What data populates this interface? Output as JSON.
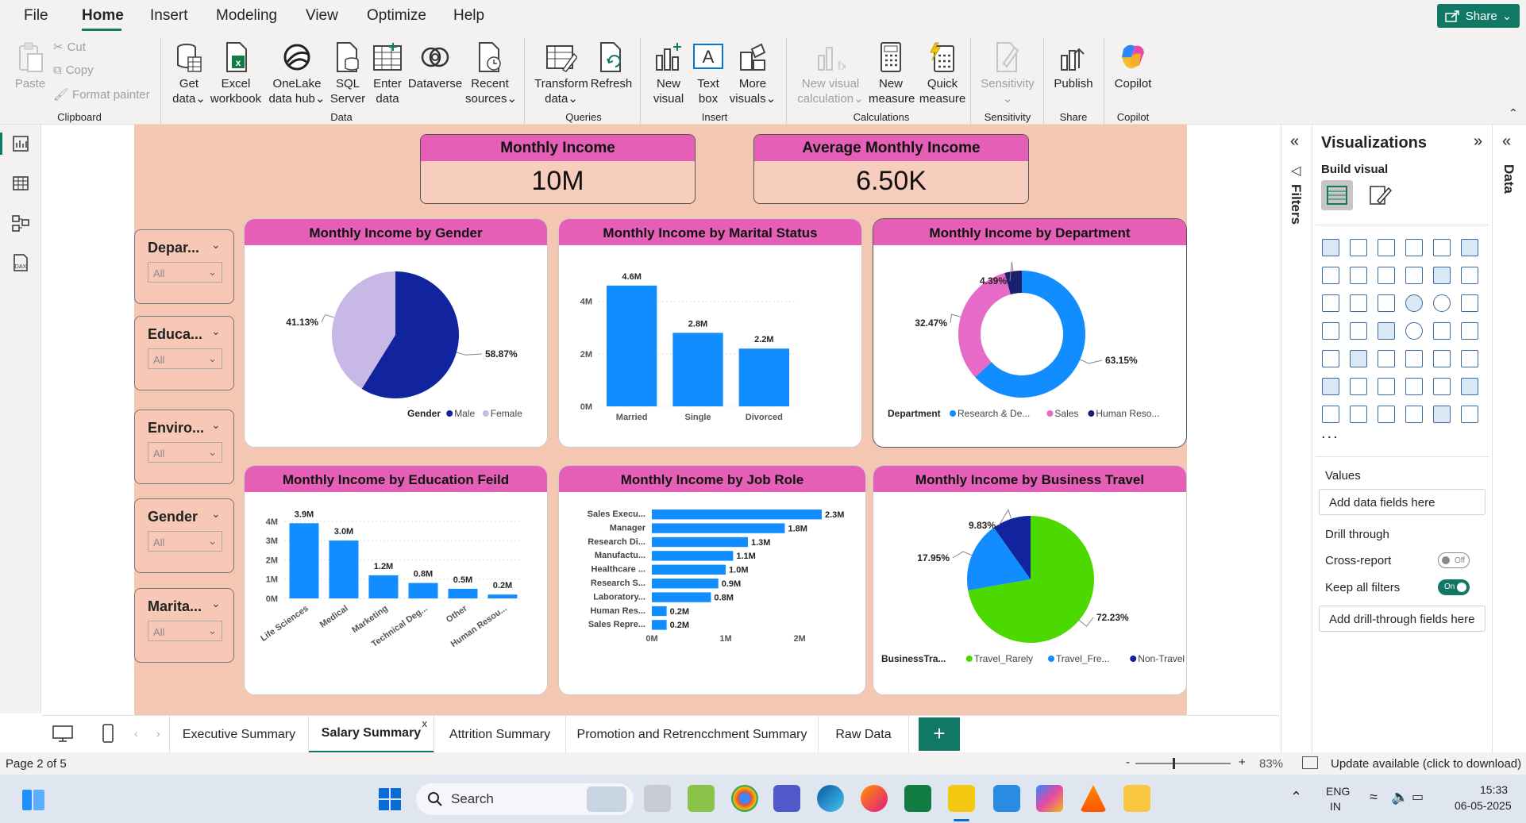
{
  "menu": {
    "file": "File",
    "home": "Home",
    "insert": "Insert",
    "modeling": "Modeling",
    "view": "View",
    "optimize": "Optimize",
    "help": "Help",
    "share": "Share"
  },
  "ribbon": {
    "clipboard": {
      "paste": "Paste",
      "cut": "Cut",
      "copy": "Copy",
      "format_painter": "Format painter",
      "label": "Clipboard"
    },
    "data": {
      "get_data": [
        "Get",
        "data"
      ],
      "excel": [
        "Excel",
        "workbook"
      ],
      "onelake": [
        "OneLake",
        "data hub"
      ],
      "sql": [
        "SQL",
        "Server"
      ],
      "enter": [
        "Enter",
        "data"
      ],
      "dataverse": "Dataverse",
      "recent": [
        "Recent",
        "sources"
      ],
      "label": "Data"
    },
    "queries": {
      "transform": [
        "Transform",
        "data"
      ],
      "refresh": "Refresh",
      "label": "Queries"
    },
    "insert": {
      "new_visual": [
        "New",
        "visual"
      ],
      "text_box": [
        "Text",
        "box"
      ],
      "more": [
        "More",
        "visuals"
      ],
      "label": "Insert"
    },
    "calculations": {
      "new_visual_calc": [
        "New visual",
        "calculation"
      ],
      "new_measure": [
        "New",
        "measure"
      ],
      "quick_measure": [
        "Quick",
        "measure"
      ],
      "label": "Calculations"
    },
    "sensitivity": {
      "btn": "Sensitivity",
      "label": "Sensitivity"
    },
    "share": {
      "publish": "Publish",
      "label": "Share"
    },
    "copilot": {
      "btn": "Copilot",
      "label": "Copilot"
    }
  },
  "kpis": [
    {
      "title": "Monthly Income",
      "value": "10M"
    },
    {
      "title": "Average Monthly Income",
      "value": "6.50K"
    }
  ],
  "slicers": [
    {
      "title": "Depar...",
      "value": "All"
    },
    {
      "title": "Educa...",
      "value": "All"
    },
    {
      "title": "Enviro...",
      "value": "All"
    },
    {
      "title": "Gender",
      "value": "All"
    },
    {
      "title": "Marita...",
      "value": "All"
    }
  ],
  "chart_data": [
    {
      "type": "pie",
      "title": "Monthly Income by Gender",
      "legend_title": "Gender",
      "categories": [
        "Male",
        "Female"
      ],
      "values": [
        58.87,
        41.13
      ],
      "labels": [
        "58.87%",
        "41.13%"
      ],
      "colors": [
        "#12239e",
        "#c7b8e6"
      ],
      "legend": "bottom-right"
    },
    {
      "type": "bar",
      "title": "Monthly Income by Marital Status",
      "categories": [
        "Married",
        "Single",
        "Divorced"
      ],
      "values": [
        4.6,
        2.8,
        2.2
      ],
      "labels": [
        "4.6M",
        "2.8M",
        "2.2M"
      ],
      "ylim": [
        0,
        5.2
      ],
      "yticks": [
        "0M",
        "2M",
        "4M"
      ],
      "color": "#118dff"
    },
    {
      "type": "pie",
      "title": "Monthly Income by Department",
      "legend_title": "Department",
      "donut": true,
      "categories": [
        "Research & De...",
        "Sales",
        "Human Reso..."
      ],
      "values": [
        63.15,
        32.47,
        4.39
      ],
      "labels": [
        "63.15%",
        "32.47%",
        "4.39%"
      ],
      "colors": [
        "#118dff",
        "#e66ac8",
        "#1a1f6e"
      ],
      "legend": "bottom"
    },
    {
      "type": "bar",
      "title": "Monthly Income by Education Feild",
      "categories": [
        "Life Sciences",
        "Medical",
        "Marketing",
        "Technical Deg...",
        "Other",
        "Human Resou..."
      ],
      "values": [
        3.9,
        3.0,
        1.2,
        0.8,
        0.5,
        0.2
      ],
      "labels": [
        "3.9M",
        "3.0M",
        "1.2M",
        "0.8M",
        "0.5M",
        "0.2M"
      ],
      "ylim": [
        0,
        4.2
      ],
      "yticks": [
        "0M",
        "1M",
        "2M",
        "3M",
        "4M"
      ],
      "color": "#118dff"
    },
    {
      "type": "bar",
      "orientation": "horizontal",
      "title": "Monthly Income by Job Role",
      "categories": [
        "Sales Execu...",
        "Manager",
        "Research Di...",
        "Manufactu...",
        "Healthcare ...",
        "Research S...",
        "Laboratory...",
        "Human Res...",
        "Sales Repre..."
      ],
      "values": [
        2.3,
        1.8,
        1.3,
        1.1,
        1.0,
        0.9,
        0.8,
        0.2,
        0.2
      ],
      "labels": [
        "2.3M",
        "1.8M",
        "1.3M",
        "1.1M",
        "1.0M",
        "0.9M",
        "0.8M",
        "0.2M",
        "0.2M"
      ],
      "xlim": [
        0,
        2.3
      ],
      "xticks": [
        "0M",
        "1M",
        "2M"
      ],
      "color": "#118dff"
    },
    {
      "type": "pie",
      "title": "Monthly Income by Business Travel",
      "legend_title": "BusinessTra...",
      "categories": [
        "Travel_Rarely",
        "Travel_Fre...",
        "Non-Travel"
      ],
      "values": [
        72.23,
        17.95,
        9.83
      ],
      "labels": [
        "72.23%",
        "17.95%",
        "9.83%"
      ],
      "colors": [
        "#4cd900",
        "#118dff",
        "#12239e"
      ],
      "legend": "bottom"
    }
  ],
  "tabs": [
    "Executive Summary",
    "Salary Summary",
    "Attrition Summary",
    "Promotion and Retrencchment Summary",
    "Raw Data"
  ],
  "tab_close": "x",
  "status": {
    "page": "Page 2 of 5",
    "zoom": "83%",
    "update": "Update available (click to download)",
    "zoom_minus": "-",
    "zoom_plus": "+"
  },
  "filters_label": "Filters",
  "data_label": "Data",
  "viz": {
    "title": "Visualizations",
    "build": "Build visual",
    "values": "Values",
    "add_fields": "Add data fields here",
    "drill": "Drill through",
    "cross": "Cross-report",
    "cross_state": "Off",
    "keep": "Keep all filters",
    "keep_state": "On",
    "add_drill": "Add drill-through fields here",
    "more": "..."
  },
  "taskbar": {
    "search": "Search",
    "lang1": "ENG",
    "lang2": "IN",
    "time": "15:33",
    "date": "06-05-2025"
  },
  "colors": {
    "accent": "#117865",
    "pink": "#e65fb7",
    "canvas": "#f4c7b3",
    "blue": "#118dff"
  }
}
